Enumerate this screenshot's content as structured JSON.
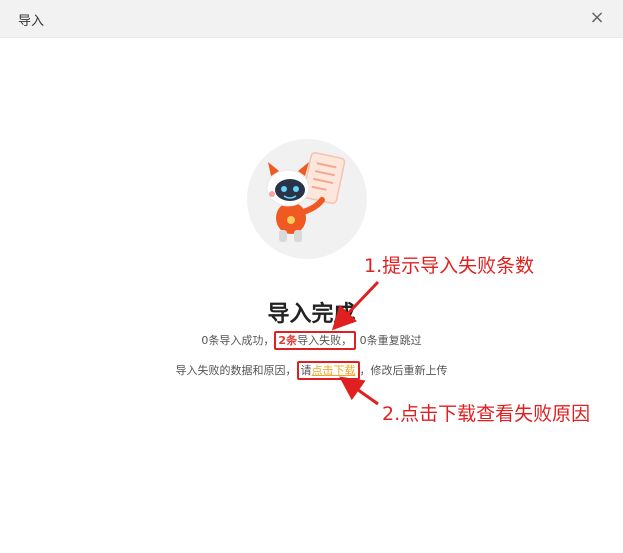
{
  "dialog": {
    "title": "导入",
    "close_glyph": "×"
  },
  "result": {
    "title": "导入完成",
    "success_text": "0条导入成功，",
    "fail_count": "2条",
    "fail_text": "导入失败，",
    "skip_text": "0条重复跳过",
    "line2_prefix": "导入失败的数据和原因，",
    "line2_please": "请",
    "download_link": "点击下载",
    "line2_suffix": "，修改后重新上传"
  },
  "annotations": {
    "note1": "1.提示导入失败条数",
    "note2": "2.点击下载查看失败原因",
    "color": "#e02020"
  },
  "colors": {
    "fail": "#e53935",
    "link": "#f5a623",
    "header_bg": "#f2f2f2"
  },
  "icons": {
    "close": "close-icon",
    "illustration": "robot-mascot-illustration"
  }
}
